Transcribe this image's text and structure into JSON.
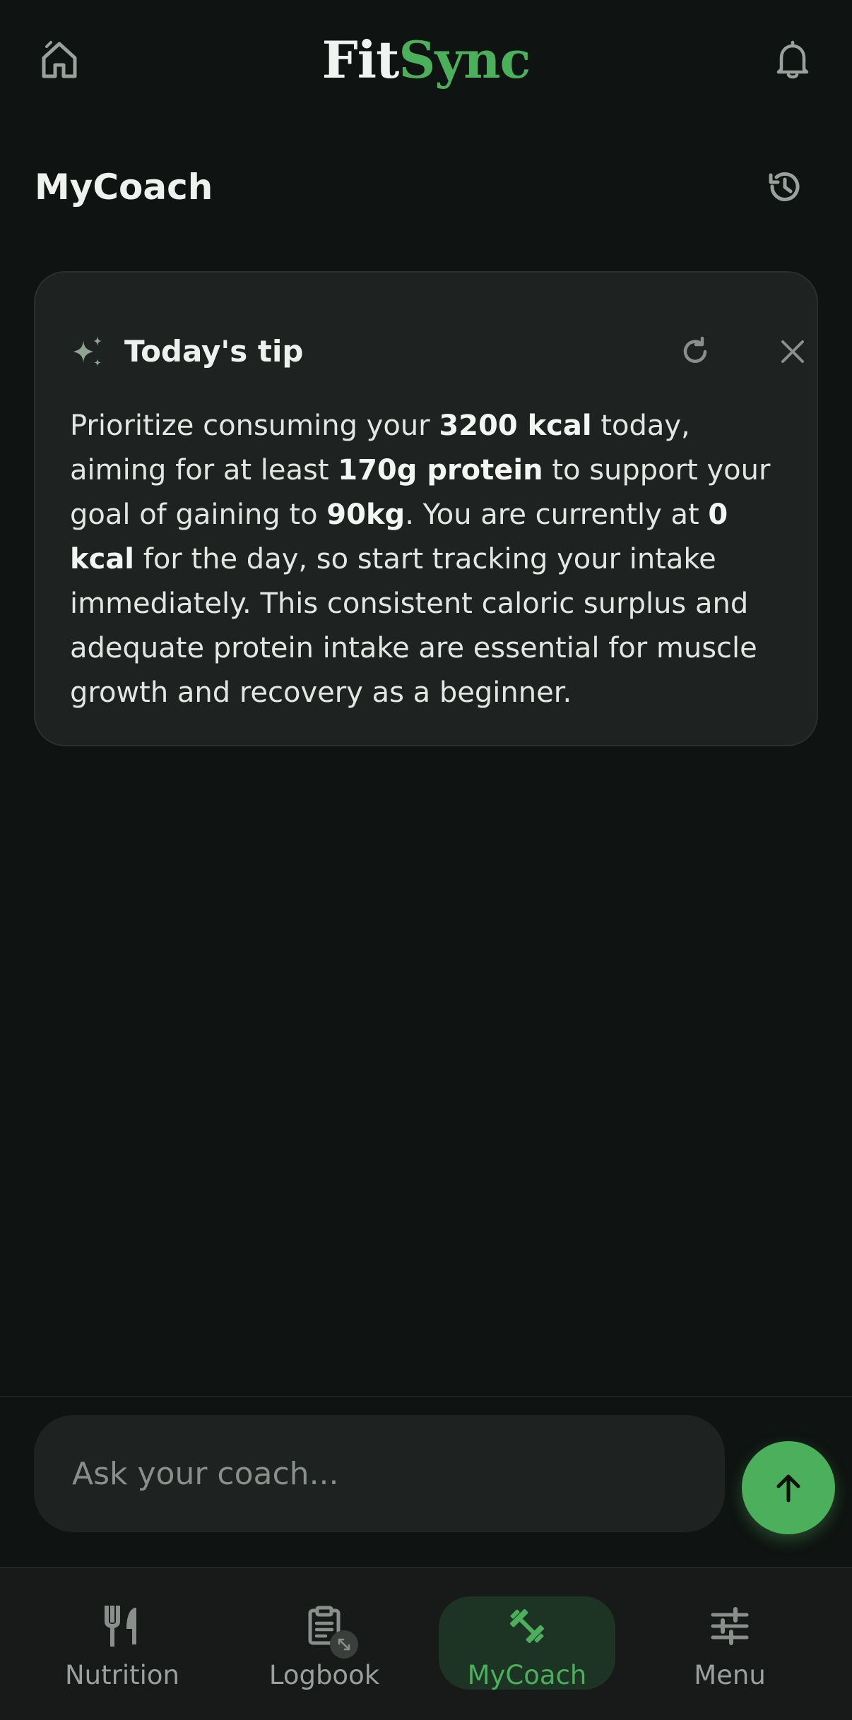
{
  "header": {
    "logo_fit": "Fit",
    "logo_sync": "Sync",
    "home_icon": "home-icon",
    "bell_icon": "bell-icon"
  },
  "page": {
    "title": "MyCoach",
    "history_icon": "history-icon"
  },
  "tip": {
    "title": "Today's tip",
    "body": [
      {
        "text": "Prioritize consuming your ",
        "bold": false
      },
      {
        "text": "3200 kcal",
        "bold": true
      },
      {
        "text": " today, aiming for at least ",
        "bold": false
      },
      {
        "text": "170g protein",
        "bold": true
      },
      {
        "text": " to support your goal of gaining to ",
        "bold": false
      },
      {
        "text": "90kg",
        "bold": true
      },
      {
        "text": ". You are currently at ",
        "bold": false
      },
      {
        "text": "0 kcal",
        "bold": true
      },
      {
        "text": " for the day, so start tracking your intake immediately. This consistent caloric surplus and adequate protein intake are essential for muscle growth and recovery as a beginner.",
        "bold": false
      }
    ]
  },
  "chat": {
    "placeholder": "Ask your coach..."
  },
  "nav": {
    "items": [
      {
        "label": "Nutrition",
        "icon": "fork-knife-icon"
      },
      {
        "label": "Logbook",
        "icon": "clipboard-icon"
      },
      {
        "label": "MyCoach",
        "icon": "dumbbell-icon",
        "active": true
      },
      {
        "label": "Menu",
        "icon": "sliders-icon"
      }
    ]
  },
  "colors": {
    "background": "#0f1311",
    "card": "#1e2220",
    "accent": "#4caf5c",
    "nav_background": "#171a19"
  }
}
